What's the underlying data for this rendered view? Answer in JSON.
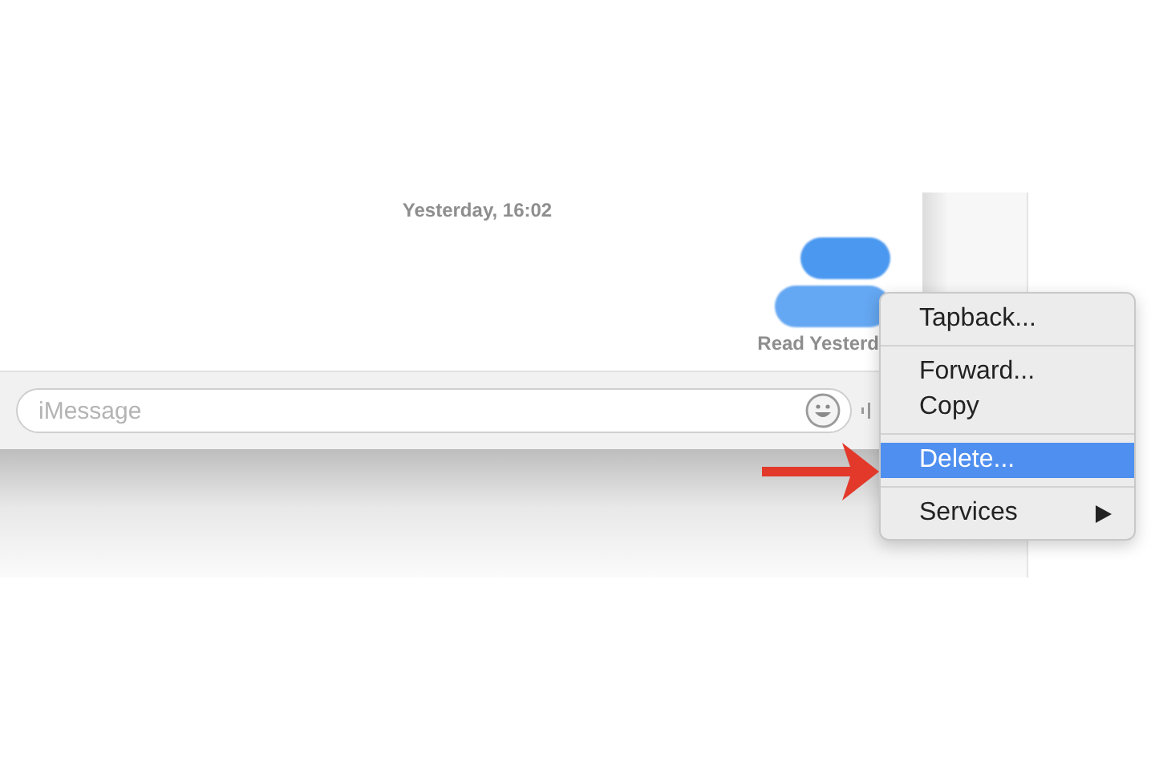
{
  "timestamp": "Yesterday, 16:02",
  "receipt": "Read Yesterd",
  "compose": {
    "placeholder": "iMessage"
  },
  "context_menu": {
    "groups": [
      [
        {
          "label": "Tapback...",
          "selected": false,
          "submenu": false
        }
      ],
      [
        {
          "label": "Forward...",
          "selected": false,
          "submenu": false
        },
        {
          "label": "Copy",
          "selected": false,
          "submenu": false
        }
      ],
      [
        {
          "label": "Delete...",
          "selected": true,
          "submenu": false
        }
      ],
      [
        {
          "label": "Services",
          "selected": false,
          "submenu": true
        }
      ]
    ]
  }
}
